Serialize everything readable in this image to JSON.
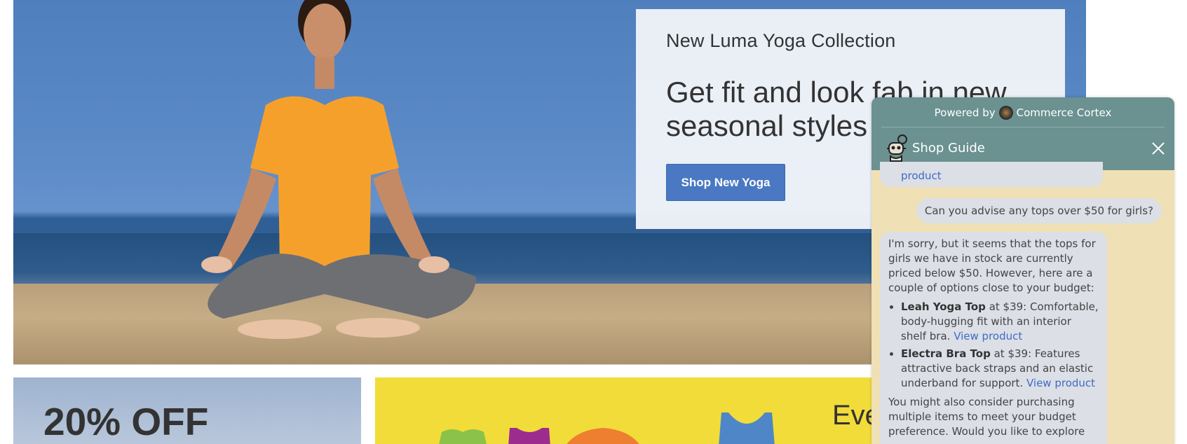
{
  "hero": {
    "subtitle": "New Luma Yoga Collection",
    "title": "Get fit and look fab in new seasonal styles",
    "button_label": "Shop New Yoga"
  },
  "promos": {
    "left_text": "20% OFF",
    "right_text": "Eve"
  },
  "chat": {
    "powered_by_prefix": "Powered by",
    "powered_by_brand": "Commerce Cortex",
    "title": "Shop Guide",
    "prev_link": "product",
    "user_message": "Can you advise any tops over $50 for girls?",
    "bot_intro": "I'm sorry, but it seems that the tops for girls we have in stock are currently priced below $50. However, here are a couple of options close to your budget:",
    "items": [
      {
        "name": "Leah Yoga Top",
        "desc": " at $39: Comfortable, body-hugging fit with an interior shelf bra. ",
        "link": "View product"
      },
      {
        "name": "Electra Bra Top",
        "desc": " at $39: Features attractive back straps and an elastic underband for support. ",
        "link": "View product"
      }
    ],
    "bot_outro": "You might also consider purchasing multiple items to meet your budget preference. Would you like to explore"
  },
  "colors": {
    "accent_button": "#4a78c2",
    "chat_header": "#6b9191",
    "chat_bg": "#efe0b5",
    "link": "#3d6bc4",
    "promo_yellow": "#f2dc3a"
  }
}
